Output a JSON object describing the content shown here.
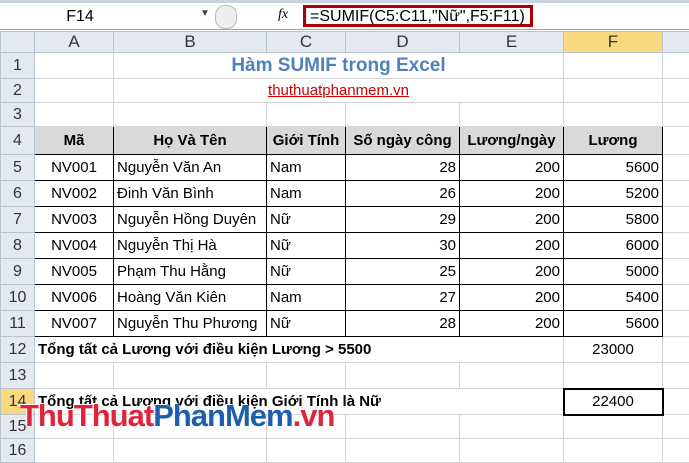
{
  "formula_bar": {
    "name_box": "F14",
    "fx": "fx",
    "formula": "=SUMIF(C5:C11,\"Nữ\",F5:F11)"
  },
  "columns": [
    "A",
    "B",
    "C",
    "D",
    "E",
    "F"
  ],
  "rows": [
    "1",
    "2",
    "3",
    "4",
    "5",
    "6",
    "7",
    "8",
    "9",
    "10",
    "11",
    "12",
    "13",
    "14",
    "15",
    "16"
  ],
  "title": "Hàm SUMIF trong Excel",
  "subtitle": "thuthuatphanmem.vn",
  "headers": [
    "Mã",
    "Họ Và Tên",
    "Giới Tính",
    "Số ngày công",
    "Lương/ngày",
    "Lương"
  ],
  "data": [
    [
      "NV001",
      "Nguyễn Văn An",
      "Nam",
      "28",
      "200",
      "5600"
    ],
    [
      "NV002",
      "Đinh Văn Bình",
      "Nam",
      "26",
      "200",
      "5200"
    ],
    [
      "NV003",
      "Nguyễn Hồng Duyên",
      "Nữ",
      "29",
      "200",
      "5800"
    ],
    [
      "NV004",
      "Nguyễn Thị Hà",
      "Nữ",
      "30",
      "200",
      "6000"
    ],
    [
      "NV005",
      "Phạm Thu Hằng",
      "Nữ",
      "25",
      "200",
      "5000"
    ],
    [
      "NV006",
      "Hoàng Văn Kiên",
      "Nam",
      "27",
      "200",
      "5400"
    ],
    [
      "NV007",
      "Nguyễn Thu Phương",
      "Nữ",
      "28",
      "200",
      "5600"
    ]
  ],
  "summary": [
    {
      "label": "Tổng tất cả Lương với điều kiện Lương > 5500",
      "value": "23000"
    },
    {
      "label": "Tổng tất cả Lương với điều kiện Giới Tính là Nữ",
      "value": "22400"
    }
  ],
  "watermark": {
    "part1": "ThuThuat",
    "part2": "PhanMem",
    "part3": ".vn"
  }
}
